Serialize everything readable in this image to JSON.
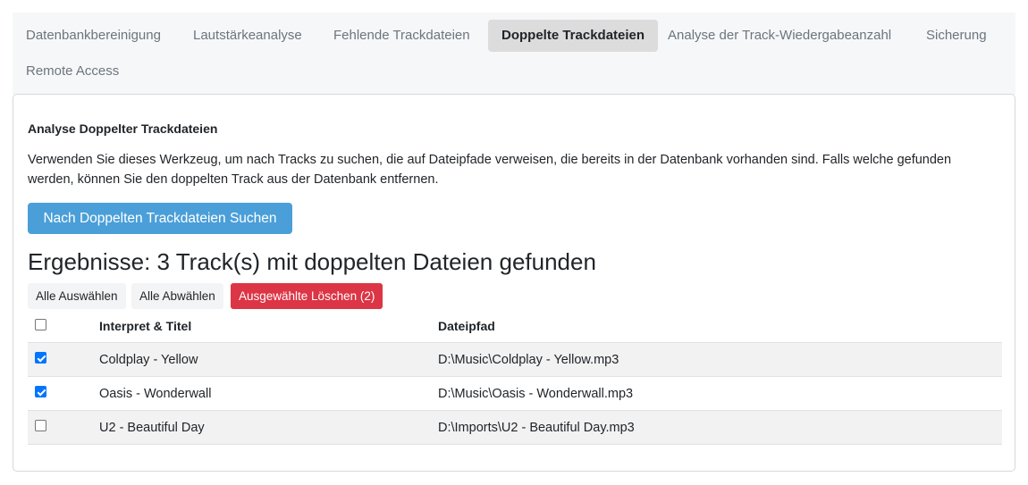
{
  "tabs": [
    {
      "label": "Datenbankbereinigung",
      "active": false
    },
    {
      "label": "Lautstärkeanalyse",
      "active": false
    },
    {
      "label": "Fehlende Trackdateien",
      "active": false
    },
    {
      "label": "Doppelte Trackdateien",
      "active": true
    },
    {
      "label": "Analyse der Track-Wiedergabeanzahl",
      "active": false
    },
    {
      "label": "Sicherung",
      "active": false
    },
    {
      "label": "Remote Access",
      "active": false
    }
  ],
  "panel": {
    "title": "Analyse Doppelter Trackdateien",
    "description": "Verwenden Sie dieses Werkzeug, um nach Tracks zu suchen, die auf Dateipfade verweisen, die bereits in der Datenbank vorhanden sind. Falls welche gefunden werden, können Sie den doppelten Track aus der Datenbank entfernen.",
    "search_button": "Nach Doppelten Trackdateien Suchen",
    "results_heading": "Ergebnisse: 3 Track(s) mit doppelten Dateien gefunden",
    "select_all": "Alle Auswählen",
    "deselect_all": "Alle Abwählen",
    "delete_selected": "Ausgewählte Löschen (2)"
  },
  "table": {
    "headers": {
      "artist_title": "Interpret & Titel",
      "path": "Dateipfad"
    },
    "rows": [
      {
        "title": "Coldplay - Yellow",
        "path": "D:\\Music\\Coldplay - Yellow.mp3",
        "checked": true
      },
      {
        "title": "Oasis - Wonderwall",
        "path": "D:\\Music\\Oasis - Wonderwall.mp3",
        "checked": true
      },
      {
        "title": "U2 - Beautiful Day",
        "path": "D:\\Imports\\U2 - Beautiful Day.mp3",
        "checked": false
      }
    ]
  },
  "colors": {
    "primary": "#4a9fd8",
    "danger": "#dc3545",
    "checkbox": "#0075ff"
  }
}
